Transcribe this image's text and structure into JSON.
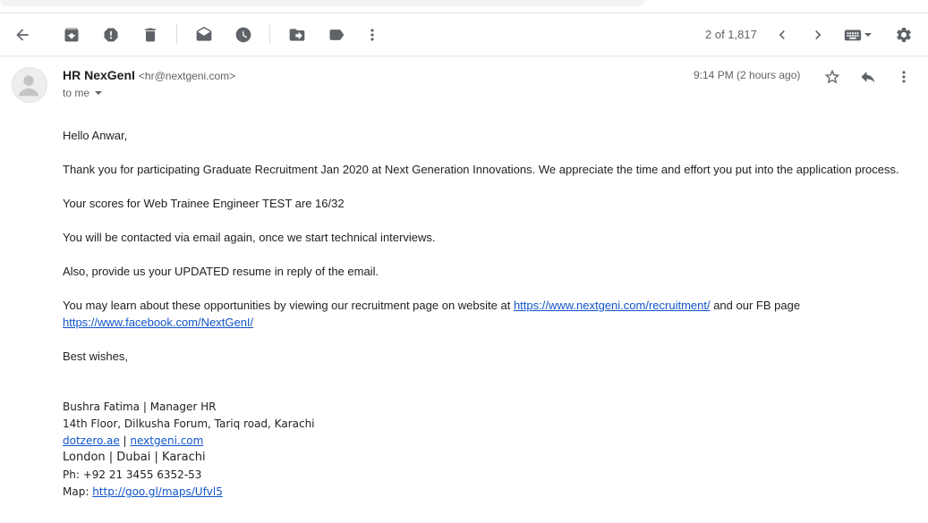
{
  "toolbar": {
    "icons": [
      "back-icon",
      "archive-icon",
      "report-spam-icon",
      "delete-icon",
      "mark-unread-icon",
      "snooze-icon",
      "move-to-icon",
      "labels-icon",
      "more-vert-icon",
      "newer-icon",
      "older-icon",
      "keyboard-icon",
      "settings-icon"
    ],
    "counter": "2 of 1,817"
  },
  "message": {
    "sender_name": "HR NexGenI",
    "sender_email": "<hr@nextgeni.com>",
    "recipient": "to me",
    "timestamp": "9:14 PM (2 hours ago)"
  },
  "body": {
    "greeting": "Hello Anwar,",
    "line1": "Thank you for participating Graduate Recruitment Jan 2020 at Next Generation Innovations. We appreciate the time and effort you put into the application process.",
    "line2": "Your scores for Web Trainee Engineer TEST are 16/32",
    "line3": "You will be contacted via email again, once we start technical interviews.",
    "line4": "Also, provide us your UPDATED resume in reply of the email.",
    "line5_prefix": "You may learn about these opportunities by viewing our recruitment page on website at ",
    "line5_link1": "https://www.nextgeni.com/recruitment/",
    "line5_mid": " and our FB page",
    "line5_link2": "https://www.facebook.com/NextGenI/",
    "closing": "Best wishes,"
  },
  "signature": {
    "name_title": "Bushra Fatima | Manager HR",
    "address": "14th Floor, Dilkusha Forum, Tariq road, Karachi",
    "link1": "dotzero.ae",
    "sep": " | ",
    "link2": "nextgeni.com",
    "cities": "London | Dubai | Karachi",
    "phone": "Ph: +92 21 3455 6352-53",
    "map_prefix": "Map: ",
    "map_link": "http://goo.gl/maps/Ufvl5"
  }
}
